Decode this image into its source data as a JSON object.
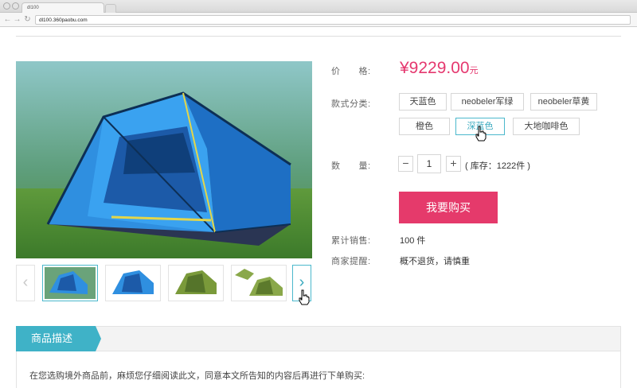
{
  "browser": {
    "tab_title": "dl100",
    "url": "dl100.360paobu.com"
  },
  "product": {
    "image_alt": "Blue camping tent",
    "thumbnails": [
      {
        "name": "thumb-blue-tent-front",
        "color": "#2f7fd8"
      },
      {
        "name": "thumb-blue-tent-side",
        "color": "#2f7fd8"
      },
      {
        "name": "thumb-green-tent",
        "color": "#7a9a3a"
      },
      {
        "name": "thumb-green-tent-open",
        "color": "#8aa84a"
      }
    ],
    "prev_arrow": "‹",
    "next_arrow": "›"
  },
  "price": {
    "label": "价　　格:",
    "amount": "¥9229.00",
    "unit": "元"
  },
  "style": {
    "label": "款式分类:",
    "options": [
      "天蓝色",
      "neobeler军绿",
      "neobeler草黄",
      "橙色",
      "深蓝色",
      "大地咖啡色"
    ],
    "selected": "深蓝色"
  },
  "quantity": {
    "label": "数　　量:",
    "minus": "−",
    "value": "1",
    "plus": "+",
    "stock": "( 库存：1222件 )"
  },
  "buy_button": "我要购买",
  "sales": {
    "label": "累计销售:",
    "value": "100 件"
  },
  "notice": {
    "label": "商家提醒:",
    "value": "概不退货，请慎重"
  },
  "description": {
    "tab": "商品描述",
    "text": "在您选购境外商品前，麻烦您仔细阅读此文，同意本文所告知的内容后再进行下单购买:"
  },
  "colors": {
    "accent": "#e5386f",
    "teal": "#3fb2c7"
  }
}
